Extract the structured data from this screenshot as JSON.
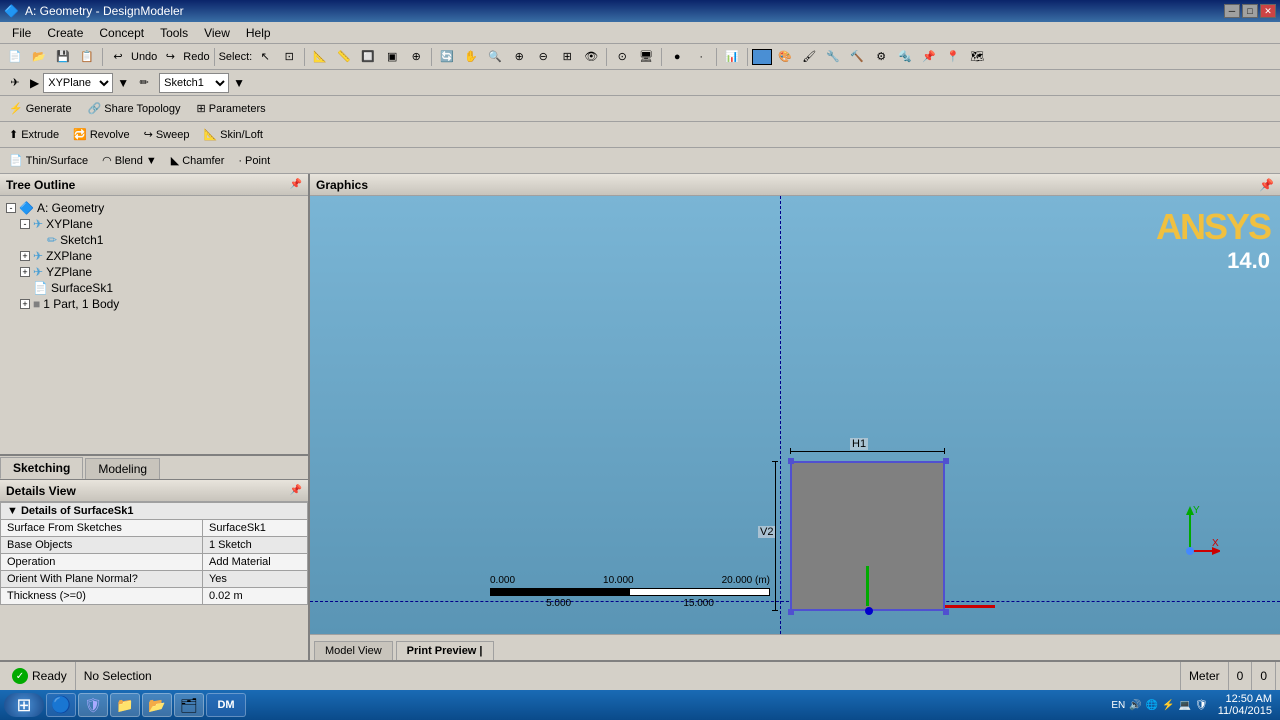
{
  "window": {
    "title": "A: Geometry - DesignModeler",
    "controls": [
      "─",
      "□",
      "✕"
    ]
  },
  "menubar": {
    "items": [
      "File",
      "Create",
      "Concept",
      "Tools",
      "View",
      "Help"
    ]
  },
  "toolbar1": {
    "undo": "Undo",
    "redo": "Redo",
    "select_label": "Select:"
  },
  "sketchrow": {
    "plane_label": "XYPlane",
    "sketch_label": "Sketch1"
  },
  "genrow": {
    "generate": "Generate",
    "share_topology": "Share Topology",
    "parameters": "Parameters"
  },
  "featrow": {
    "extrude": "Extrude",
    "revolve": "Revolve",
    "sweep": "Sweep",
    "skin_loft": "Skin/Loft"
  },
  "modrow": {
    "thin_surface": "Thin/Surface",
    "blend": "Blend",
    "chamfer": "Chamfer",
    "point": "Point"
  },
  "left_panel": {
    "tree_header": "Tree Outline",
    "tree_items": [
      {
        "level": 0,
        "label": "A: Geometry",
        "type": "root",
        "expanded": true
      },
      {
        "level": 1,
        "label": "XYPlane",
        "type": "plane",
        "expanded": true
      },
      {
        "level": 2,
        "label": "Sketch1",
        "type": "sketch"
      },
      {
        "level": 1,
        "label": "ZXPlane",
        "type": "plane"
      },
      {
        "level": 1,
        "label": "YZPlane",
        "type": "plane"
      },
      {
        "level": 1,
        "label": "SurfaceSk1",
        "type": "surface"
      },
      {
        "level": 1,
        "label": "1 Part, 1 Body",
        "type": "body",
        "expanded": true
      }
    ]
  },
  "tabs": {
    "sketching": "Sketching",
    "modeling": "Modeling",
    "active": "Sketching"
  },
  "details": {
    "header": "Details View",
    "section": "Details of SurfaceSk1",
    "rows": [
      {
        "label": "Surface From Sketches",
        "value": "SurfaceSk1"
      },
      {
        "label": "Base Objects",
        "value": "1 Sketch"
      },
      {
        "label": "Operation",
        "value": "Add Material"
      },
      {
        "label": "Orient With Plane Normal?",
        "value": "Yes"
      },
      {
        "label": "Thickness (>=0)",
        "value": "0.02 m"
      }
    ]
  },
  "graphics": {
    "header": "Graphics",
    "ansys_logo": "ANSYS",
    "ansys_version": "14.0",
    "dim_h_label": "H1",
    "dim_v_label": "V2",
    "scale": {
      "labels": [
        "0.000",
        "10.000",
        "20.000 (m)"
      ],
      "sub_labels": [
        "5.000",
        "15.000"
      ]
    }
  },
  "bottom_tabs": {
    "model_view": "Model View",
    "print_preview": "Print Preview |",
    "active": "Print Preview |"
  },
  "statusbar": {
    "status": "Ready",
    "selection": "No Selection",
    "unit": "Meter",
    "val1": "0",
    "val2": "0"
  },
  "taskbar": {
    "start": "⊞",
    "apps": [
      "🔵",
      "🛡",
      "📁",
      "📂",
      "🗂",
      "DM"
    ],
    "time": "12:50 AM",
    "date": "11/04/2015",
    "language": "EN"
  }
}
